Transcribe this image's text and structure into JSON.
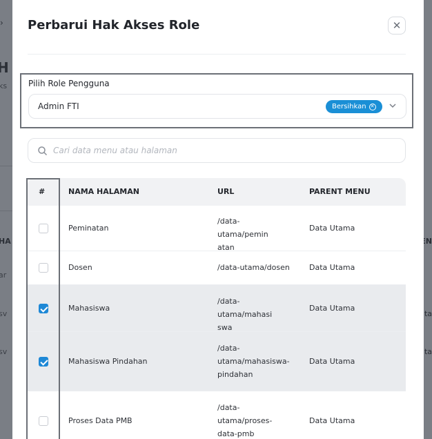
{
  "modal": {
    "title": "Perbarui Hak Akses Role",
    "close_icon": "close-icon"
  },
  "role": {
    "label": "Pilih Role Pengguna",
    "selected": "Admin FTI",
    "clear_label": "Bersihkan"
  },
  "search": {
    "placeholder": "Cari data menu atau halaman"
  },
  "table": {
    "headers": {
      "check": "#",
      "name": "NAMA HALAMAN",
      "url": "URL",
      "parent": "PARENT MENU"
    },
    "rows": [
      {
        "name": "Peminatan",
        "url": "/data-utama/peminatan",
        "parent": "Data Utama",
        "checked": false
      },
      {
        "name": "Dosen",
        "url": "/data-utama/dosen",
        "parent": "Data Utama",
        "checked": false
      },
      {
        "name": "Mahasiswa",
        "url": "/data-utama/mahasiswa",
        "parent": "Data Utama",
        "checked": true
      },
      {
        "name": "Mahasiswa Pindahan",
        "url": "/data-utama/mahasiswa-pindahan",
        "parent": "Data Utama",
        "checked": true
      },
      {
        "name": "Proses Data PMB",
        "url": "/data-utama/proses-data-pmb",
        "parent": "Data Utama",
        "checked": false
      }
    ]
  },
  "colors": {
    "accent": "#1a8fd6",
    "checked_row": "#e9ebee"
  }
}
